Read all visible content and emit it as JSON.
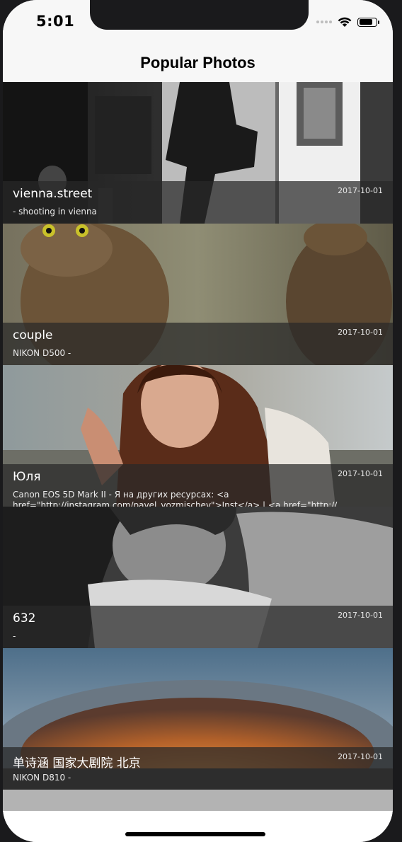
{
  "status": {
    "time": "5:01",
    "battery_level": 0.85
  },
  "nav": {
    "title": "Popular Photos"
  },
  "photos": [
    {
      "title": "vienna.street",
      "date": "2017-10-01",
      "description": " - shooting in vienna"
    },
    {
      "title": "couple",
      "date": "2017-10-01",
      "description": "NIKON D500 -"
    },
    {
      "title": "Юля",
      "date": "2017-10-01",
      "description": "Canon EOS 5D Mark II - Я на других ресурсах: <a href=\"http://instagram.com/pavel_vozmischev\">Inst</a> | <a href=\"http://"
    },
    {
      "title": "632",
      "date": "2017-10-01",
      "description": " -"
    },
    {
      "title": "单诗涵 国家大剧院 北京",
      "date": "2017-10-01",
      "description": "NIKON D810 -"
    }
  ]
}
